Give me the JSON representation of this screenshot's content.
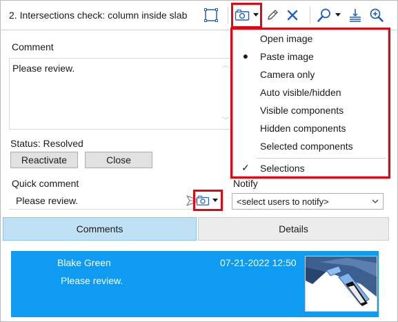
{
  "header": {
    "title": "2. Intersections check: column inside slab",
    "icons": [
      "select-area-icon",
      "camera-icon",
      "dropdown-caret-icon",
      "pencil-icon",
      "close-x-icon",
      "zoom-icon",
      "dropdown-caret-icon",
      "clip-plane-icon",
      "zoom-in-icon"
    ]
  },
  "comment_section": {
    "label": "Comment",
    "value": "Please review."
  },
  "status": {
    "text": "Status: Resolved",
    "reactivate_label": "Reactivate",
    "close_label": "Close"
  },
  "quick_comment": {
    "label": "Quick comment",
    "value": "Please review."
  },
  "notify": {
    "label": "Notify",
    "selected": "<select users to notify>"
  },
  "tabs": [
    {
      "label": "Comments",
      "active": true
    },
    {
      "label": "Details",
      "active": false
    }
  ],
  "comments": [
    {
      "author": "Blake Green",
      "date": "07-21-2022 12:50",
      "text": "Please review."
    }
  ],
  "camera_menu": {
    "items": [
      {
        "label": "Open image",
        "mark": ""
      },
      {
        "label": "Paste image",
        "mark": "●"
      },
      {
        "label": "Camera only",
        "mark": ""
      },
      {
        "label": "Auto visible/hidden",
        "mark": ""
      },
      {
        "label": "Visible components",
        "mark": ""
      },
      {
        "label": "Hidden components",
        "mark": ""
      },
      {
        "label": "Selected components",
        "mark": ""
      },
      {
        "label": "Selections",
        "mark": "✓"
      }
    ]
  },
  "colors": {
    "accent_blue": "#0f9bf2",
    "active_tab": "#bfe0f5",
    "highlight_red": "#e30613",
    "icon_blue": "#1f5fbf"
  }
}
